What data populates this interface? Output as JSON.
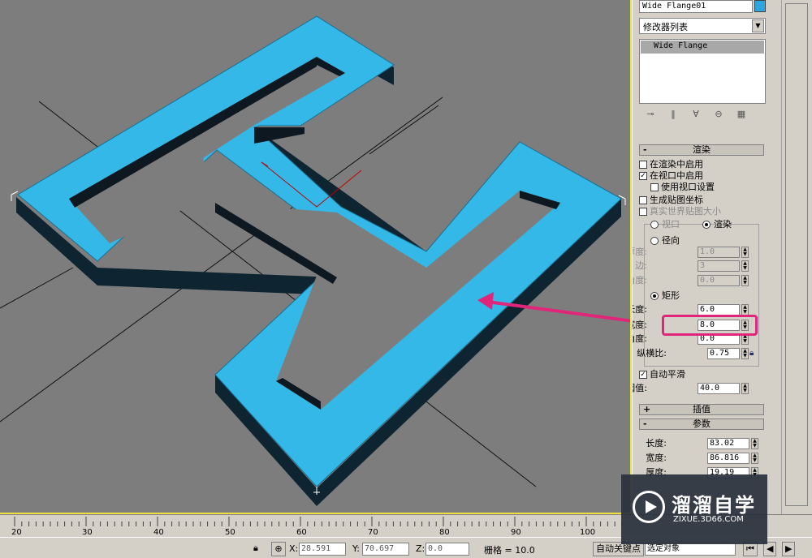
{
  "command_panel": {
    "object_name": "Wide Flange01",
    "object_color": "#2ea7e0",
    "modifier_list": "修改器列表",
    "stack_item": "Wide Flange",
    "stack_tools": [
      "pin-stack-icon",
      "show-end-result-icon",
      "make-unique-icon",
      "remove-modifier-icon",
      "configure-sets-icon"
    ]
  },
  "rendering": {
    "header": "渲染",
    "enable_in_renderer": "在渲染中启用",
    "enable_in_viewport": "在视口中启用",
    "use_viewport_settings": "使用视口设置",
    "gen_mapping_coords": "生成贴图坐标",
    "real_world_map_size": "真实世界贴图大小",
    "viewport_radio": "视口",
    "renderer_radio": "渲染",
    "radial": "径向",
    "thickness_lbl": "厚度:",
    "thickness_val": "1.0",
    "sides_lbl": "边:",
    "sides_val": "3",
    "angle1_lbl": "角度:",
    "angle1_val": "0.0",
    "rectangular": "矩形",
    "length_lbl": "长度:",
    "length_val": "6.0",
    "width_lbl": "宽度:",
    "width_val": "8.0",
    "angle2_lbl": "角度:",
    "angle2_val": "0.0",
    "aspect_lbl": "纵横比:",
    "aspect_val": "0.75",
    "auto_smooth": "自动平滑",
    "threshold_lbl": "阈值:",
    "threshold_val": "40.0"
  },
  "interpolation": {
    "header": "插值"
  },
  "parameters": {
    "header": "参数",
    "length_lbl": "长度:",
    "length_val": "83.02",
    "width_lbl": "宽度:",
    "width_val": "86.816",
    "thickness_lbl": "厚度:",
    "thickness_val": "19.19"
  },
  "timeline": {
    "ticks": [
      "20",
      "30",
      "40",
      "50",
      "60",
      "70",
      "80",
      "90",
      "100"
    ]
  },
  "status": {
    "x_lbl": "X:",
    "x_val": "28.591",
    "y_lbl": "Y:",
    "y_val": "70.697",
    "z_lbl": "Z:",
    "z_val": "0.0",
    "grid": "栅格 = 10.0",
    "auto_key": "自动关键点",
    "selected": "选定对象"
  },
  "watermark": {
    "title": "溜溜自学",
    "url": "ZIXUE.3D66.COM"
  }
}
